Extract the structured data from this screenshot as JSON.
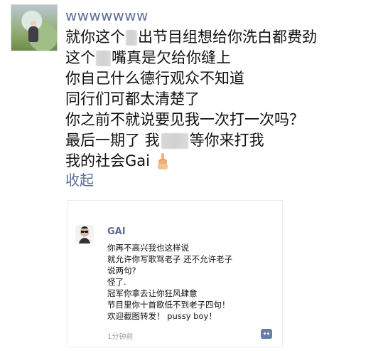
{
  "post": {
    "username": "wwwwwww",
    "lines": {
      "l1_a": "就你这个",
      "l1_b": "出节目组想给你洗白都费劲",
      "l2_a": "这个",
      "l2_b": "嘴真是欠给你缝上",
      "l3": "你自己什么德行观众不知道",
      "l4": "同行们可都太清楚了",
      "l5": "你之前不就说要见我一次打一次吗？",
      "l6_a": "最后一期了 我",
      "l6_b": "等你来打我",
      "l7": "我的社会Gai"
    },
    "collapse_label": "收起",
    "icons": {
      "avatar": "avatar",
      "middle_finger": "middle-finger-emoji"
    }
  },
  "embedded_comment": {
    "name": "GAI",
    "lines": [
      "你再不高兴我也这样说",
      "就允许你写歌骂老子 还不允许老子",
      "说两句?",
      "怪了.",
      "冠军你拿去让你狂风肆意",
      "节目里你十首歌低不到老子四句！",
      "欢迎截图转发！ pussy boy！"
    ],
    "time": "1分钟前",
    "icons": {
      "avatar": "sunglasses-avatar-icon",
      "comment": "comment-icon"
    }
  }
}
